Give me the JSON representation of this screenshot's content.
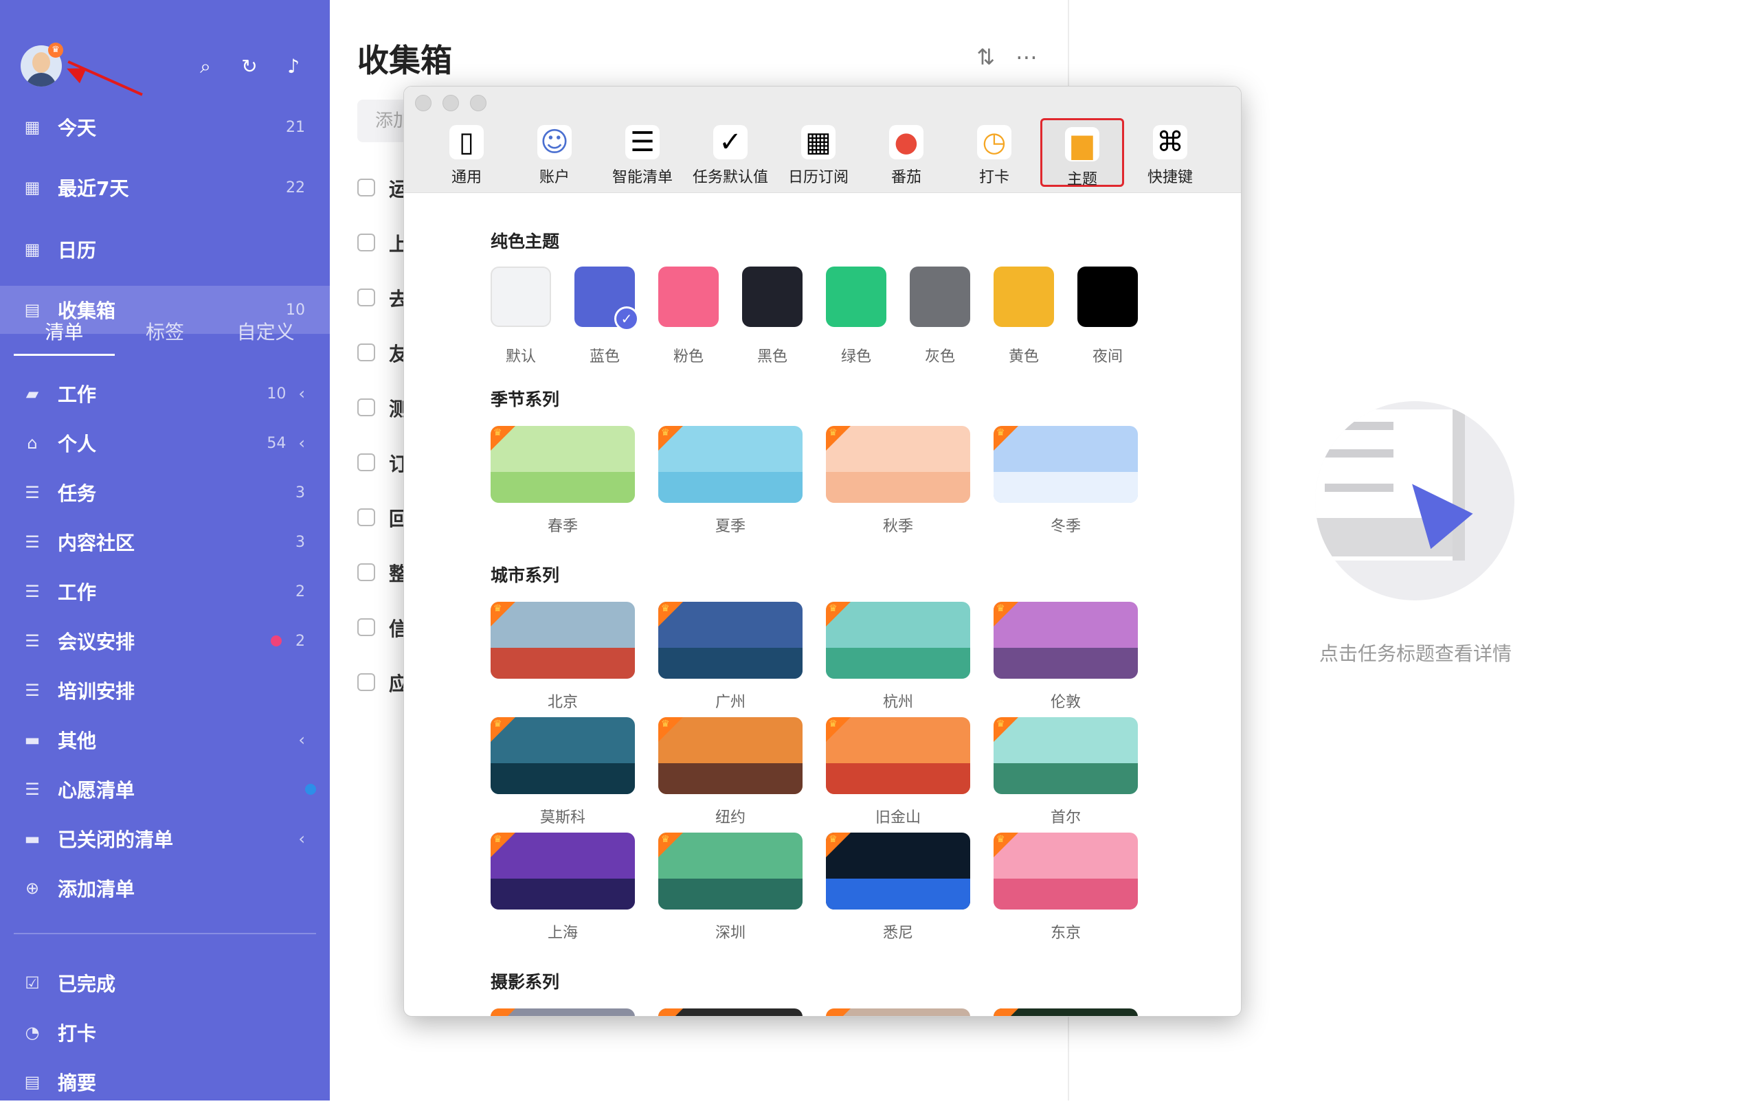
{
  "sidebar": {
    "search_icon": "search-icon",
    "sync_icon": "sync-icon",
    "bell_icon": "bell-icon",
    "smart": [
      {
        "label": "今天",
        "count": "21",
        "icon": "calendar-day-icon",
        "badge_num": "21"
      },
      {
        "label": "最近7天",
        "count": "22",
        "icon": "calendar-week-icon"
      },
      {
        "label": "日历",
        "count": "",
        "icon": "calendar-icon"
      },
      {
        "label": "收集箱",
        "count": "10",
        "icon": "inbox-icon"
      }
    ],
    "tabs": [
      "清单",
      "标签",
      "自定义"
    ],
    "lists": [
      {
        "label": "工作",
        "count": "10",
        "icon": "briefcase-icon",
        "chevron": "‹"
      },
      {
        "label": "个人",
        "count": "54",
        "icon": "house-icon",
        "chevron": "‹"
      },
      {
        "label": "任务",
        "count": "3",
        "icon": "list-icon"
      },
      {
        "label": "内容社区",
        "count": "3",
        "icon": "list-icon"
      },
      {
        "label": "工作",
        "count": "2",
        "icon": "list-icon"
      },
      {
        "label": "会议安排",
        "count": "2",
        "icon": "list-icon",
        "dot": "#f0437a"
      },
      {
        "label": "培训安排",
        "count": "",
        "icon": "list-icon"
      },
      {
        "label": "其他",
        "count": "",
        "icon": "folder-icon",
        "chevron": "‹"
      },
      {
        "label": "心愿清单",
        "count": "",
        "icon": "list-icon",
        "dot": "#2d8fe8"
      },
      {
        "label": "已关闭的清单",
        "count": "",
        "icon": "archive-folder-icon",
        "chevron": "‹"
      },
      {
        "label": "添加清单",
        "count": "",
        "icon": "plus-circle-icon"
      }
    ],
    "bottom": [
      {
        "label": "已完成",
        "icon": "checkbox-icon"
      },
      {
        "label": "打卡",
        "icon": "clock-icon"
      },
      {
        "label": "摘要",
        "icon": "summary-icon"
      }
    ]
  },
  "main": {
    "title": "收集箱",
    "add_placeholder": "添加",
    "tasks": [
      "运",
      "上",
      "去",
      "友",
      "测",
      "订",
      "回",
      "整",
      "信",
      "应"
    ]
  },
  "detail": {
    "empty_text": "点击任务标题查看详情"
  },
  "modal": {
    "toolbar": [
      {
        "label": "通用",
        "icon": "phone-icon"
      },
      {
        "label": "账户",
        "icon": "user-icon"
      },
      {
        "label": "智能清单",
        "icon": "smart-list-icon"
      },
      {
        "label": "任务默认值",
        "icon": "clipboard-check-icon"
      },
      {
        "label": "日历订阅",
        "icon": "calendar-rss-icon"
      },
      {
        "label": "番茄",
        "icon": "tomato-icon"
      },
      {
        "label": "打卡",
        "icon": "clock-pin-icon"
      },
      {
        "label": "主题",
        "icon": "paint-roller-icon"
      },
      {
        "label": "快捷键",
        "icon": "command-key-icon"
      }
    ],
    "selected_tab": "主题",
    "solid_title": "纯色主题",
    "solid": [
      {
        "label": "默认",
        "color": "#f2f3f5"
      },
      {
        "label": "蓝色",
        "color": "#5464d4",
        "selected": true
      },
      {
        "label": "粉色",
        "color": "#f6648a"
      },
      {
        "label": "黑色",
        "color": "#20222c"
      },
      {
        "label": "绿色",
        "color": "#28c47c"
      },
      {
        "label": "灰色",
        "color": "#6e7075"
      },
      {
        "label": "黄色",
        "color": "#f3b52a"
      },
      {
        "label": "夜间",
        "color": "#000000"
      }
    ],
    "season_title": "季节系列",
    "seasons": [
      {
        "label": "春季",
        "sky": "#c4e8a8",
        "ground": "#9bd576"
      },
      {
        "label": "夏季",
        "sky": "#8fd6ec",
        "ground": "#6bc3e3"
      },
      {
        "label": "秋季",
        "sky": "#fbd0b8",
        "ground": "#f7b895"
      },
      {
        "label": "冬季",
        "sky": "#b4d2f7",
        "ground": "#e8f1fd"
      }
    ],
    "city_title": "城市系列",
    "cities": [
      {
        "label": "北京",
        "sky": "#9bb8cc",
        "ground": "#c94a3a"
      },
      {
        "label": "广州",
        "sky": "#3a5f9e",
        "ground": "#1e4a6e"
      },
      {
        "label": "杭州",
        "sky": "#7fd0c8",
        "ground": "#3fa98a"
      },
      {
        "label": "伦敦",
        "sky": "#c07ad0",
        "ground": "#6f4c8c"
      },
      {
        "label": "莫斯科",
        "sky": "#2f6f88",
        "ground": "#10394a"
      },
      {
        "label": "纽约",
        "sky": "#e98a3a",
        "ground": "#6a3a2a"
      },
      {
        "label": "旧金山",
        "sky": "#f6904a",
        "ground": "#d04430"
      },
      {
        "label": "首尔",
        "sky": "#9fe0d8",
        "ground": "#3a8c70"
      },
      {
        "label": "上海",
        "sky": "#6a3ab0",
        "ground": "#2a2060"
      },
      {
        "label": "深圳",
        "sky": "#5ab88a",
        "ground": "#2a7060"
      },
      {
        "label": "悉尼",
        "sky": "#0c1a2a",
        "ground": "#2a6adf"
      },
      {
        "label": "东京",
        "sky": "#f7a0b8",
        "ground": "#e45c82"
      }
    ],
    "photo_title": "摄影系列",
    "photos": [
      "#8a8ea0",
      "#2a2a2a",
      "#c8b0a0",
      "#1a3020"
    ]
  }
}
